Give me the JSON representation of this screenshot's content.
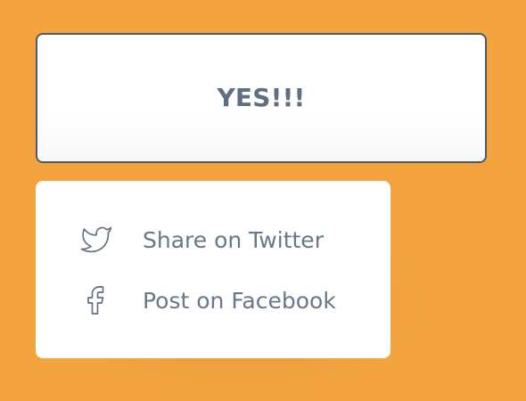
{
  "main": {
    "confirm_label": "YES!!!"
  },
  "share_menu": {
    "items": [
      {
        "label": "Share on Twitter",
        "icon": "twitter-icon"
      },
      {
        "label": "Post on Facebook",
        "icon": "facebook-icon"
      }
    ]
  },
  "colors": {
    "background": "#f3a43e",
    "button_border": "#4d5a68",
    "button_text": "#5f6e80",
    "menu_text": "#687789",
    "icon_stroke": "#5f6e80"
  }
}
